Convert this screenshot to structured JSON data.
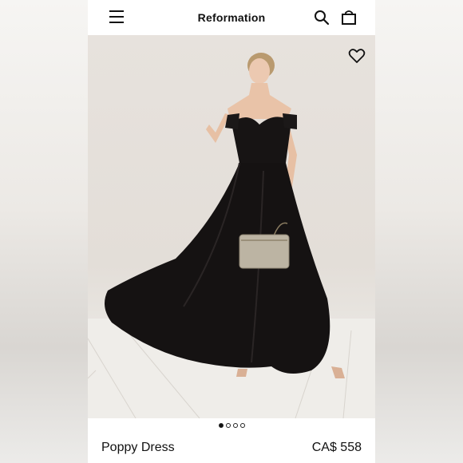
{
  "header": {
    "brand": "Reformation",
    "menu_icon": "hamburger-menu-icon",
    "search_icon": "search-icon",
    "bag_icon": "shopping-bag-icon"
  },
  "product_image": {
    "favorite_icon": "heart-icon",
    "carousel": {
      "total": 4,
      "active_index": 0
    },
    "colors": {
      "dress": "#141212",
      "background": "#e5e0da",
      "floor": "#efede9"
    }
  },
  "product": {
    "name": "Poppy Dress",
    "price": "CA$ 558"
  }
}
